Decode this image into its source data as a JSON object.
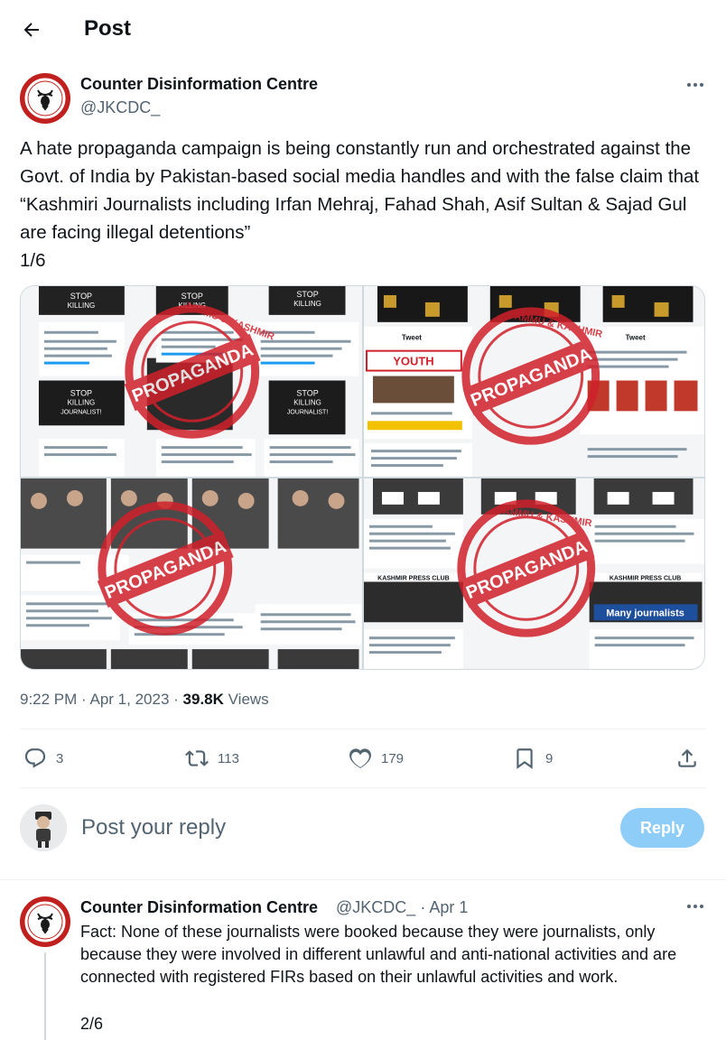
{
  "header": {
    "title": "Post"
  },
  "post": {
    "author_name": "Counter Disinformation Centre",
    "author_handle": "@JKCDC_",
    "text": "A hate propaganda campaign is being constantly run and orchestrated against the Govt. of India by Pakistan-based social media handles and with the false claim that “Kashmiri Journalists including Irfan Mehraj, Fahad Shah, Asif Sultan & Sajad Gul are facing illegal detentions”\n1/6",
    "time": "9:22 PM",
    "date": "Apr 1, 2023",
    "views_count": "39.8K",
    "views_label": "Views",
    "media": {
      "stamp_text": "PROPAGANDA",
      "stamp_ring_text": "JAMMU & KASHMIR",
      "image_texts": {
        "stop": "STOP",
        "killing": "KILLING",
        "journalist": "JOURNALIST!",
        "tweet": "Tweet",
        "youth": "YOUTH",
        "press_club": "KASHMIR PRESS CLUB",
        "many_journalists": "Many journalists"
      }
    },
    "actions": {
      "replies": "3",
      "reposts": "113",
      "likes": "179",
      "bookmarks": "9"
    }
  },
  "reply_box": {
    "placeholder": "Post your reply",
    "button_label": "Reply"
  },
  "thread_reply": {
    "author_name": "Counter Disinformation Centre",
    "author_handle": "@JKCDC_",
    "separator": "·",
    "date": "Apr 1",
    "text": "Fact: None of these journalists were booked because they were journalists, only because they were involved in different unlawful and anti-national activities and are connected with registered FIRs based on their unlawful activities and work.",
    "counter": "2/6"
  },
  "colors": {
    "accent": "#1d9bf0",
    "reply_button_disabled": "#8ecdf8",
    "secondary_text": "#536471",
    "logo_red": "#c0201e",
    "stamp_red": "#d0202a"
  }
}
